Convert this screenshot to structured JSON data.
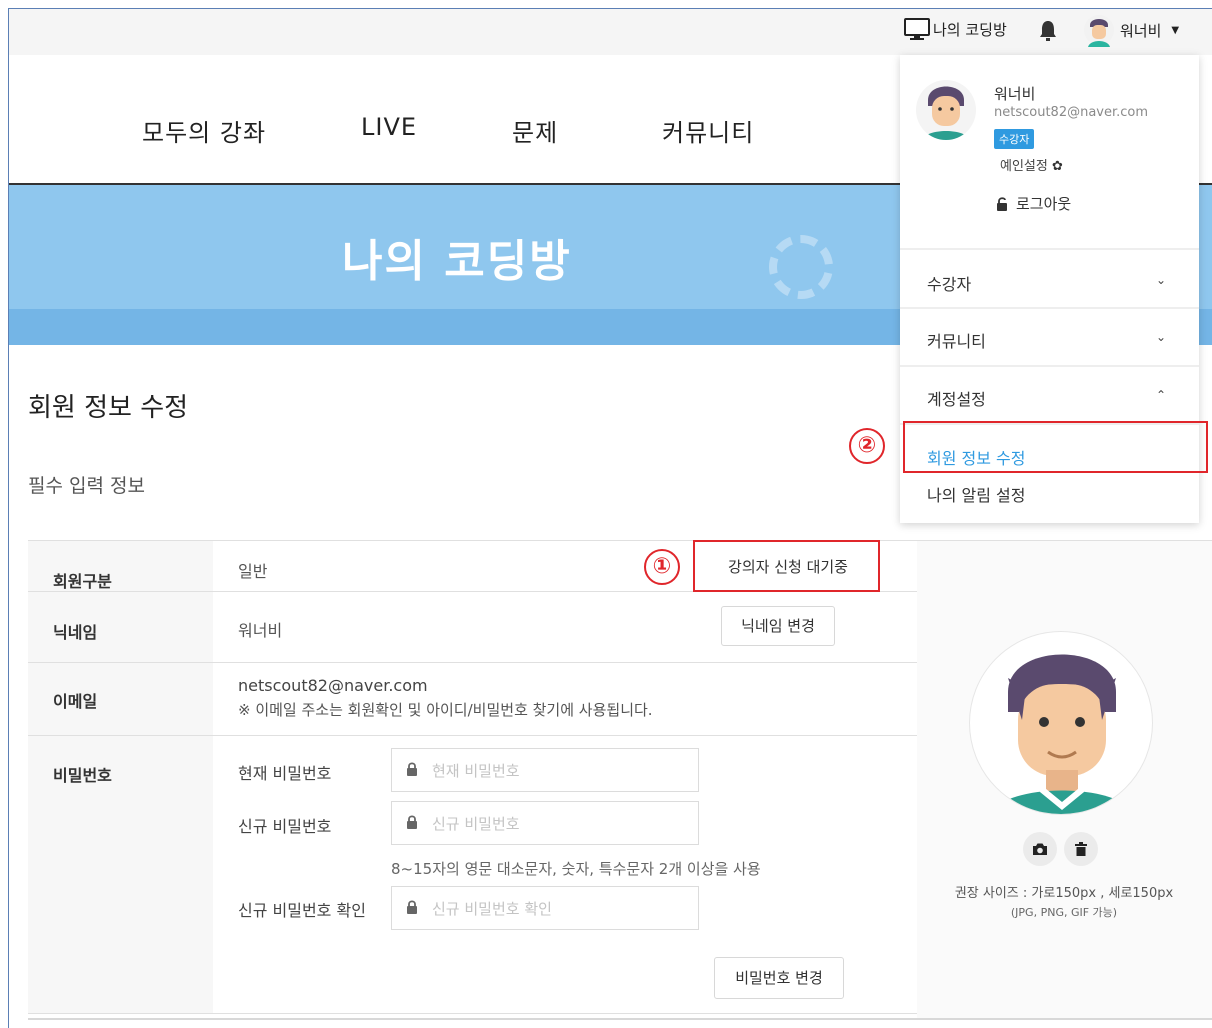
{
  "utilbar": {
    "room_label": "나의 코딩방",
    "user_name": "워너비"
  },
  "nav": {
    "items": [
      "모두의 강좌",
      "LIVE",
      "문제",
      "커뮤니티"
    ]
  },
  "banner": {
    "title": "나의 코딩방"
  },
  "page": {
    "title": "회원 정보 수정",
    "section": "필수 입력 정보"
  },
  "form": {
    "member_type": {
      "label": "회원구분",
      "value": "일반",
      "button": "강의자 신청 대기중"
    },
    "nickname": {
      "label": "닉네임",
      "value": "워너비",
      "button": "닉네임 변경"
    },
    "email": {
      "label": "이메일",
      "value": "netscout82@naver.com",
      "note": "※ 이메일 주소는 회원확인 및 아이디/비밀번호 찾기에 사용됩니다."
    },
    "password": {
      "label": "비밀번호",
      "current_label": "현재 비밀번호",
      "current_placeholder": "현재 비밀번호",
      "new_label": "신규 비밀번호",
      "new_placeholder": "신규 비밀번호",
      "rule": "8~15자의 영문 대소문자, 숫자, 특수문자 2개 이상을 사용",
      "confirm_label": "신규 비밀번호 확인",
      "confirm_placeholder": "신규 비밀번호 확인",
      "button": "비밀번호 변경"
    }
  },
  "profile": {
    "size_note": "권장 사이즈 : 가로150px , 세로150px",
    "format_note": "(JPG, PNG, GIF 가능)"
  },
  "dropdown": {
    "name": "워너비",
    "email": "netscout82@naver.com",
    "badge": "수강자",
    "pref": "예인설정",
    "logout": "로그아웃",
    "sections": [
      "수강자",
      "커뮤니티",
      "계정설정"
    ],
    "sub_items": [
      "회원 정보 수정",
      "나의 알림 설정"
    ]
  },
  "annotations": {
    "one": "①",
    "two": "②"
  },
  "colors": {
    "accent": "#2f9ae0",
    "highlight": "#e0262b",
    "banner": "#8fc7ee"
  }
}
